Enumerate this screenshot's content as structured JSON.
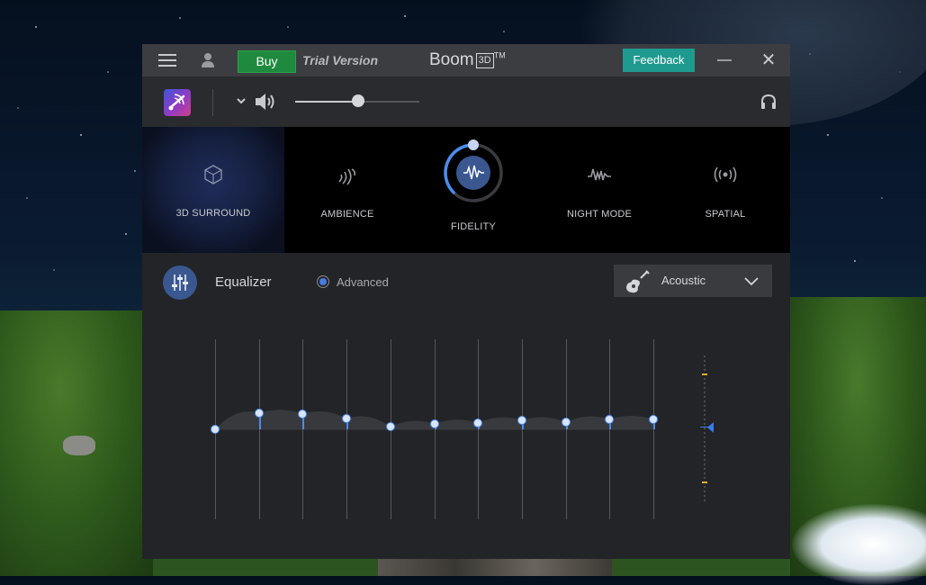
{
  "window": {
    "buy_label": "Buy",
    "trial_label": "Trial Version",
    "brand_name": "Boom",
    "brand_box": "3D",
    "brand_tm": "TM",
    "feedback_label": "Feedback"
  },
  "toolbar": {
    "volume_level": 0.51
  },
  "effects": [
    {
      "id": "3d-surround",
      "label": "3D SURROUND",
      "active": true
    },
    {
      "id": "ambience",
      "label": "AMBIENCE",
      "active": false
    },
    {
      "id": "fidelity",
      "label": "FIDELITY",
      "active": false,
      "level": 0.55
    },
    {
      "id": "night-mode",
      "label": "NIGHT MODE",
      "active": false
    },
    {
      "id": "spatial",
      "label": "SPATIAL",
      "active": false
    }
  ],
  "equalizer": {
    "title": "Equalizer",
    "mode_label": "Advanced",
    "mode_selected": true,
    "preset": "Acoustic",
    "bands_gain": [
      0.0,
      0.18,
      0.17,
      0.12,
      0.03,
      0.06,
      0.07,
      0.1,
      0.08,
      0.11,
      0.11
    ],
    "master_gain": 0.0
  },
  "colors": {
    "accent": "#4a8cf0",
    "buy": "#1f8a3e",
    "feedback": "#1f9a8e",
    "gain_mark": "#e0b21c"
  },
  "icons": {
    "menu": "hamburger-icon",
    "user": "user-icon",
    "minimize": "minimize-icon",
    "close": "close-icon",
    "logo": "boom-logo-icon",
    "speaker": "speaker-icon",
    "headphones": "headphones-icon",
    "equalizer": "equalizer-sliders-icon",
    "preset": "guitar-icon"
  }
}
